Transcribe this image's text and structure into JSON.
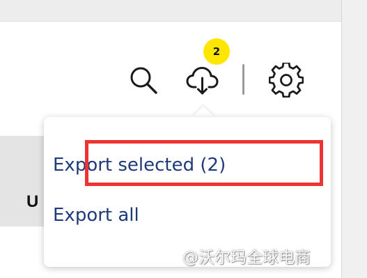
{
  "toolbar": {
    "search_icon": "search-icon",
    "export_icon": "cloud-download-icon",
    "settings_icon": "gear-icon",
    "export_badge_count": "2"
  },
  "export_menu": {
    "items": [
      {
        "label": "Export selected (2)",
        "highlighted": true
      },
      {
        "label": "Export all",
        "highlighted": false
      }
    ]
  },
  "background": {
    "row_text_fragment": "U"
  },
  "watermark": {
    "text": "@沃尔玛全球电商"
  },
  "colors": {
    "badge": "#ffe600",
    "menu_text": "#1e3a78",
    "highlight_border": "#ee3333",
    "icon": "#1a1a1a"
  }
}
